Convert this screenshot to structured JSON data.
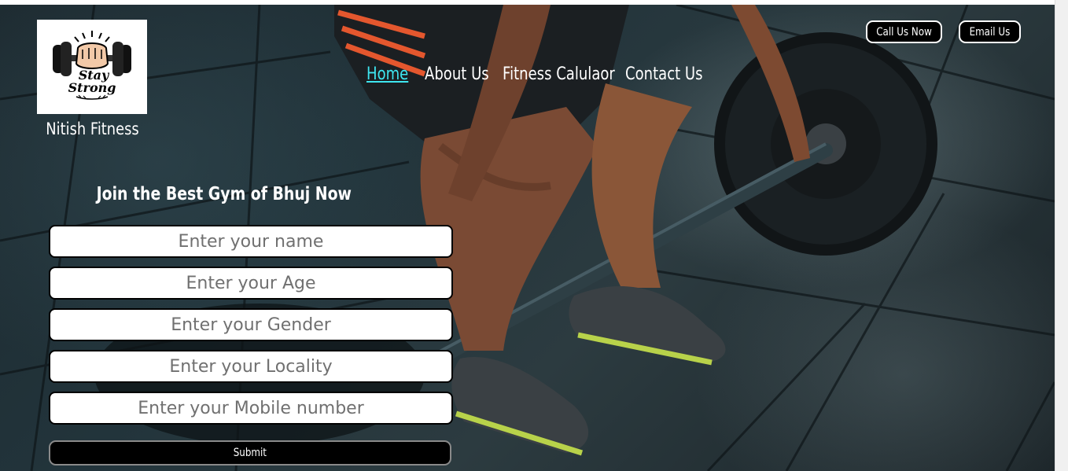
{
  "brand": {
    "logo_text_line1": "Stay",
    "logo_text_line2": "Strong",
    "name": "Nitish Fitness"
  },
  "nav": {
    "items": [
      {
        "label": "Home",
        "active": true
      },
      {
        "label": "About Us",
        "active": false
      },
      {
        "label": "Fitness Calulaor",
        "active": false
      },
      {
        "label": "Contact Us",
        "active": false
      }
    ]
  },
  "contact_buttons": {
    "call_label": "Call Us Now",
    "email_label": "Email Us"
  },
  "form": {
    "title": "Join the Best Gym of Bhuj Now",
    "fields": [
      {
        "placeholder": "Enter your name",
        "value": ""
      },
      {
        "placeholder": "Enter your Age",
        "value": ""
      },
      {
        "placeholder": "Enter your Gender",
        "value": ""
      },
      {
        "placeholder": "Enter your Locality",
        "value": ""
      },
      {
        "placeholder": "Enter your Mobile number",
        "value": ""
      }
    ],
    "submit_label": "Submit"
  },
  "colors": {
    "active_link": "#3ee6f0",
    "button_bg": "#000000",
    "text": "#ffffff"
  }
}
